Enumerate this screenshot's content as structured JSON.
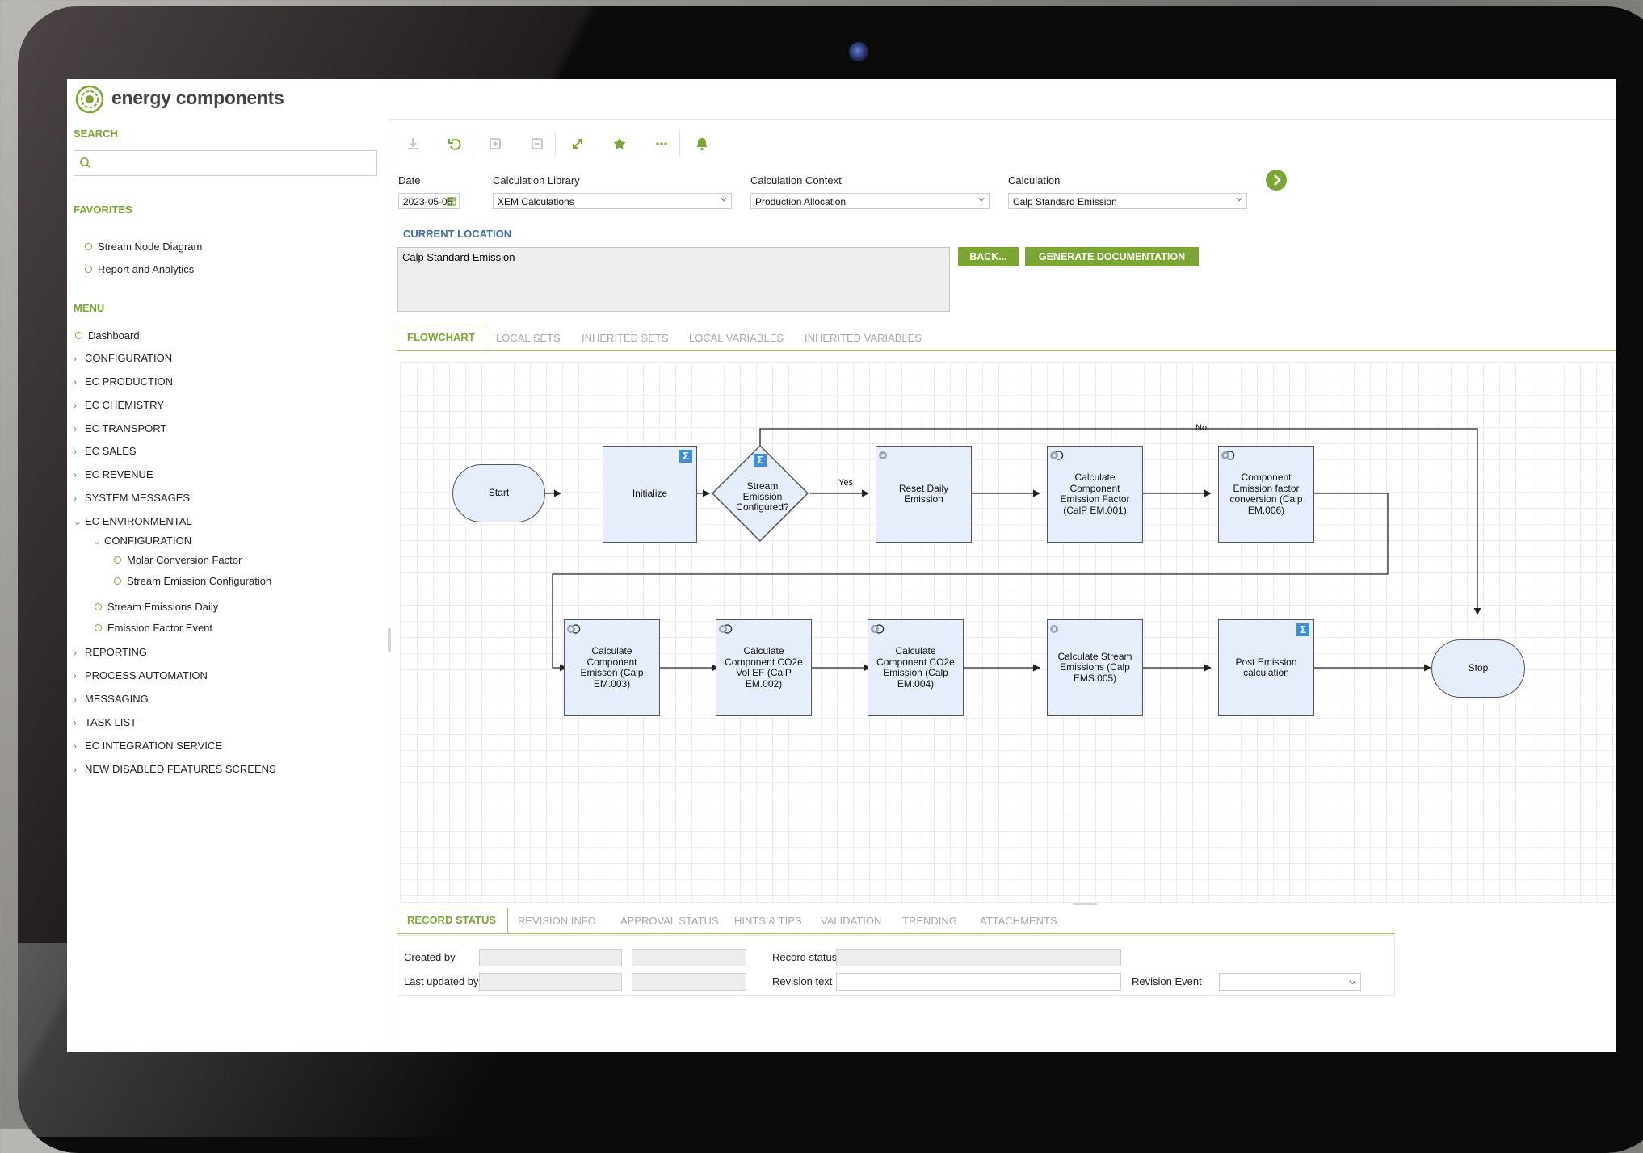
{
  "brand": {
    "name": "energy components"
  },
  "colors": {
    "accent": "#7aa631",
    "link_blue": "#3e6fa6",
    "node_fill": "#e6eefb"
  },
  "sidebar": {
    "search_label": "SEARCH",
    "search_placeholder": "",
    "favorites_label": "FAVORITES",
    "favorites": [
      "Stream Node Diagram",
      "Report and Analytics"
    ],
    "menu_label": "MENU",
    "menu": [
      {
        "label": "Dashboard",
        "type": "leaf"
      },
      {
        "label": "CONFIGURATION",
        "type": "collapsed"
      },
      {
        "label": "EC PRODUCTION",
        "type": "collapsed"
      },
      {
        "label": "EC CHEMISTRY",
        "type": "collapsed"
      },
      {
        "label": "EC TRANSPORT",
        "type": "collapsed"
      },
      {
        "label": "EC SALES",
        "type": "collapsed"
      },
      {
        "label": "EC REVENUE",
        "type": "collapsed"
      },
      {
        "label": "SYSTEM MESSAGES",
        "type": "collapsed"
      },
      {
        "label": "EC ENVIRONMENTAL",
        "type": "expanded"
      },
      {
        "label": "CONFIGURATION",
        "type": "expanded"
      },
      {
        "label": "Molar Conversion Factor",
        "type": "leaf"
      },
      {
        "label": "Stream Emission Configuration",
        "type": "leaf"
      },
      {
        "label": "Stream Emissions Daily",
        "type": "leaf"
      },
      {
        "label": "Emission Factor Event",
        "type": "leaf"
      },
      {
        "label": "REPORTING",
        "type": "collapsed"
      },
      {
        "label": "PROCESS AUTOMATION",
        "type": "collapsed"
      },
      {
        "label": "MESSAGING",
        "type": "collapsed"
      },
      {
        "label": "TASK LIST",
        "type": "collapsed"
      },
      {
        "label": "EC INTEGRATION SERVICE",
        "type": "collapsed"
      },
      {
        "label": "NEW DISABLED FEATURES SCREENS",
        "type": "collapsed"
      }
    ]
  },
  "toolbar": {
    "icons": [
      "download-icon",
      "undo-icon",
      "add-icon",
      "remove-icon",
      "expand-icon",
      "star-icon",
      "more-icon",
      "bell-icon"
    ]
  },
  "form": {
    "date_label": "Date",
    "date_value": "2023-05-05",
    "library_label": "Calculation Library",
    "library_value": "XEM Calculations",
    "context_label": "Calculation Context",
    "context_value": "Production Allocation",
    "calculation_label": "Calculation",
    "calculation_value": "Calp Standard Emission"
  },
  "current_location": {
    "label": "CURRENT LOCATION",
    "value": "Calp Standard Emission",
    "back_button": "BACK...",
    "generate_button": "GENERATE DOCUMENTATION"
  },
  "main_tabs": [
    "FLOWCHART",
    "LOCAL SETS",
    "INHERITED SETS",
    "LOCAL VARIABLES",
    "INHERITED VARIABLES"
  ],
  "flowchart": {
    "start": "Start",
    "initialize": "Initialize",
    "decision": "Stream Emission Configured?",
    "yes_label": "Yes",
    "no_label": "No",
    "reset": "Reset Daily Emission",
    "calc_ef": "Calculate Component Emission Factor (CalP EM.001)",
    "conv": "Component Emission factor conversion (Calp EM.006)",
    "calc_em": "Calculate Component Emisson (Calp EM.003)",
    "co2e_vol": "Calculate Component CO2e Vol EF (CalP EM.002)",
    "co2e_em": "Calculate Component CO2e Emission (Calp EM.004)",
    "stream_em": "Calculate Stream Emissions (Calp EMS.005)",
    "post": "Post Emission calculation",
    "stop": "Stop"
  },
  "bottom_tabs": [
    "RECORD STATUS",
    "REVISION INFO",
    "APPROVAL STATUS",
    "HINTS & TIPS",
    "VALIDATION",
    "TRENDING",
    "ATTACHMENTS"
  ],
  "record_status": {
    "created_by_label": "Created by",
    "last_updated_label": "Last updated by",
    "record_status_label": "Record status",
    "revision_text_label": "Revision text",
    "revision_event_label": "Revision Event"
  }
}
